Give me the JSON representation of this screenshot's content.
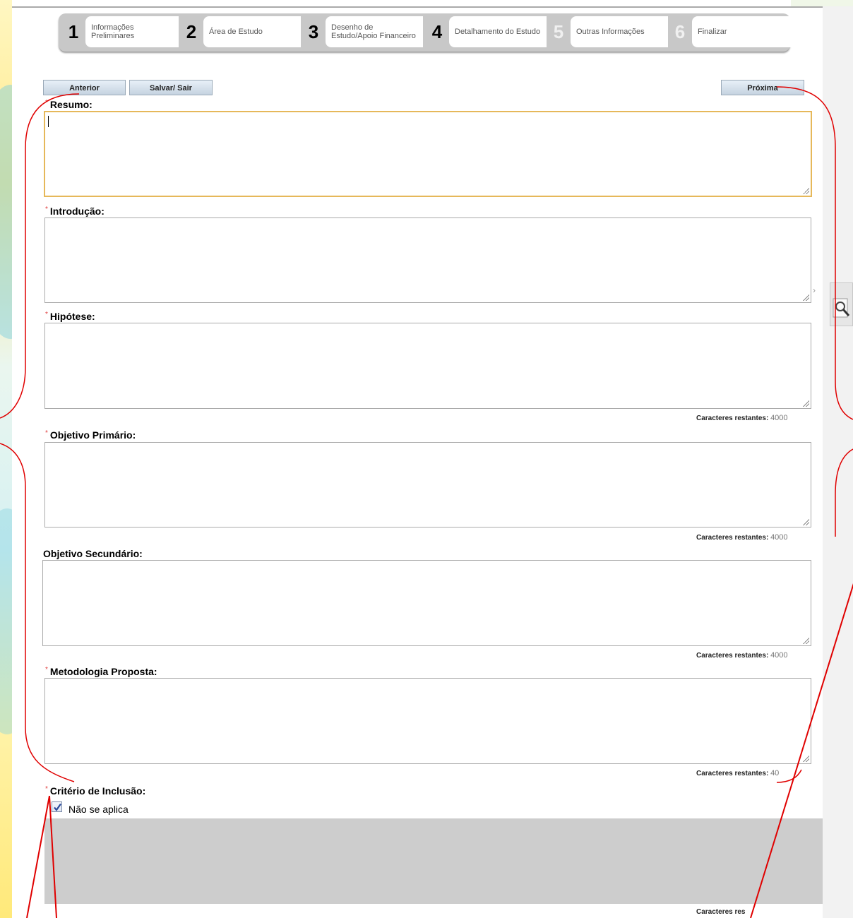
{
  "wizard": {
    "steps": [
      {
        "number": "1",
        "label": "Informações\nPreliminares"
      },
      {
        "number": "2",
        "label": "Área de Estudo"
      },
      {
        "number": "3",
        "label": "Desenho de\nEstudo/Apoio Financeiro"
      },
      {
        "number": "4",
        "label": "Detalhamento do Estudo"
      },
      {
        "number": "5",
        "label": "Outras Informações"
      },
      {
        "number": "6",
        "label": "Finalizar"
      }
    ]
  },
  "toolbar": {
    "prev_label": "Anterior",
    "save_label": "Salvar/ Sair",
    "next_label": "Próxima"
  },
  "fields": {
    "resumo": "Resumo:",
    "introducao": "Introdução:",
    "hipotese": "Hipótese:",
    "objetivo_primario": "Objetivo Primário:",
    "objetivo_secundario": "Objetivo Secundário:",
    "metodologia": "Metodologia Proposta:",
    "criterio_inclusao": "Critério de Inclusão:"
  },
  "required_mark": "*",
  "counter_label": "Caracteres restantes:",
  "counter_value": "4000",
  "counter_partial_1": "40",
  "counter_partial_2": "Caracteres res",
  "checkbox": {
    "label": "Não se aplica",
    "checked": true
  },
  "side_arrow": "›",
  "colors": {
    "annotation": "#e00000",
    "focus_border": "#e6b85a",
    "required": "#e04040"
  }
}
